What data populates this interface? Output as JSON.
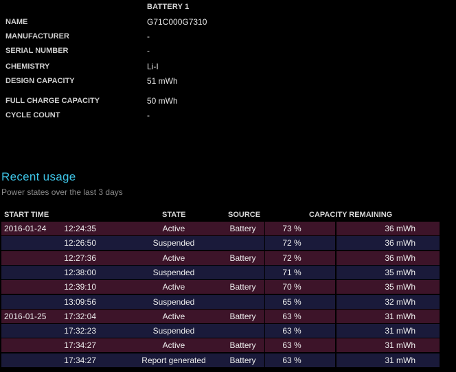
{
  "battery": {
    "header": "BATTERY 1",
    "fields": [
      {
        "label": "NAME",
        "value": "G71C000G7310"
      },
      {
        "label": "MANUFACTURER",
        "value": "-"
      },
      {
        "label": "SERIAL NUMBER",
        "value": "-"
      },
      {
        "label": "CHEMISTRY",
        "value": "Li-I"
      },
      {
        "label": "DESIGN CAPACITY",
        "value": "51 mWh"
      },
      {
        "label": "FULL CHARGE CAPACITY",
        "value": "50 mWh"
      },
      {
        "label": "CYCLE COUNT",
        "value": "-"
      }
    ]
  },
  "recent_usage": {
    "title": "Recent usage",
    "subtitle": "Power states over the last 3 days",
    "columns": {
      "start_time": "START TIME",
      "state": "STATE",
      "source": "SOURCE",
      "capacity": "CAPACITY REMAINING"
    },
    "rows": [
      {
        "date": "2016-01-24",
        "time": "12:24:35",
        "state": "Active",
        "source": "Battery",
        "percent": "73 %",
        "mwh": "36 mWh"
      },
      {
        "date": "",
        "time": "12:26:50",
        "state": "Suspended",
        "source": "",
        "percent": "72 %",
        "mwh": "36 mWh"
      },
      {
        "date": "",
        "time": "12:27:36",
        "state": "Active",
        "source": "Battery",
        "percent": "72 %",
        "mwh": "36 mWh"
      },
      {
        "date": "",
        "time": "12:38:00",
        "state": "Suspended",
        "source": "",
        "percent": "71 %",
        "mwh": "35 mWh"
      },
      {
        "date": "",
        "time": "12:39:10",
        "state": "Active",
        "source": "Battery",
        "percent": "70 %",
        "mwh": "35 mWh"
      },
      {
        "date": "",
        "time": "13:09:56",
        "state": "Suspended",
        "source": "",
        "percent": "65 %",
        "mwh": "32 mWh"
      },
      {
        "date": "2016-01-25",
        "time": "17:32:04",
        "state": "Active",
        "source": "Battery",
        "percent": "63 %",
        "mwh": "31 mWh"
      },
      {
        "date": "",
        "time": "17:32:23",
        "state": "Suspended",
        "source": "",
        "percent": "63 %",
        "mwh": "31 mWh"
      },
      {
        "date": "",
        "time": "17:34:27",
        "state": "Active",
        "source": "Battery",
        "percent": "63 %",
        "mwh": "31 mWh"
      },
      {
        "date": "",
        "time": "17:34:27",
        "state": "Report generated",
        "source": "Battery",
        "percent": "63 %",
        "mwh": "31 mWh"
      }
    ]
  },
  "colors": {
    "background": "#000000",
    "accent_title": "#3ec4e6",
    "row_active": "#3d1429",
    "row_suspended": "#1a1a3a"
  }
}
